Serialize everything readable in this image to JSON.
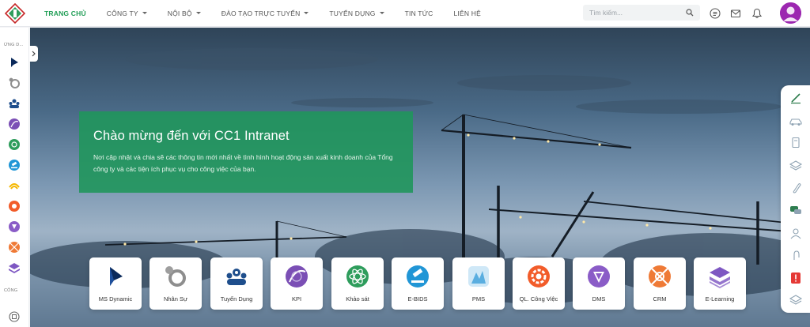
{
  "nav": {
    "items": [
      {
        "label": "TRANG CHỦ",
        "active": true,
        "dropdown": false
      },
      {
        "label": "CÔNG TY",
        "active": false,
        "dropdown": true
      },
      {
        "label": "NỘI BỘ",
        "active": false,
        "dropdown": true
      },
      {
        "label": "ĐÀO TẠO TRỰC TUYẾN",
        "active": false,
        "dropdown": true
      },
      {
        "label": "TUYỂN DỤNG",
        "active": false,
        "dropdown": true
      },
      {
        "label": "TIN TỨC",
        "active": false,
        "dropdown": false
      },
      {
        "label": "LIÊN HỆ",
        "active": false,
        "dropdown": false
      }
    ],
    "search_placeholder": "Tìm kiếm...",
    "icons": [
      "search-icon",
      "document-icon",
      "mail-icon",
      "bell-icon",
      "user-avatar"
    ]
  },
  "left_rail": {
    "section_apps_label": "ỨNG D...",
    "section_tools_label": "CÔNG",
    "icons": [
      "ms-dynamic-icon",
      "nhan-su-icon",
      "tuyen-dung-icon",
      "kpi-icon",
      "khao-sat-icon",
      "e-bids-icon",
      "pms-icon",
      "ql-cong-viec-icon",
      "dms-icon",
      "crm-icon",
      "e-learning-icon",
      "tool-icon"
    ]
  },
  "hero": {
    "title": "Chào mừng đến với CC1 Intranet",
    "subtitle": "Nơi cập nhật và chia sẽ các thông tin mới nhất về tình hình hoạt động sản xuất kinh doanh của Tổng công ty và các tiện ích phục vụ cho công việc của bạn."
  },
  "apps": [
    {
      "label": "MS Dynamic",
      "icon": "ms-dynamic-icon",
      "color": "#0b2a5b"
    },
    {
      "label": "Nhân Sự",
      "icon": "nhan-su-icon",
      "color": "#8e8e8e"
    },
    {
      "label": "Tuyển Dụng",
      "icon": "tuyen-dung-icon",
      "color": "#1e4e8c"
    },
    {
      "label": "KPI",
      "icon": "kpi-icon",
      "color": "#7b4fb5"
    },
    {
      "label": "Khảo sát",
      "icon": "khao-sat-icon",
      "color": "#2e9d5c"
    },
    {
      "label": "E-BIDS",
      "icon": "e-bids-icon",
      "color": "#2196d6"
    },
    {
      "label": "PMS",
      "icon": "pms-icon",
      "color": "#5aaee0"
    },
    {
      "label": "QL. Công Việc",
      "icon": "ql-cong-viec-icon",
      "color": "#f25c2a"
    },
    {
      "label": "DMS",
      "icon": "dms-icon",
      "color": "#8a5cc7"
    },
    {
      "label": "CRM",
      "icon": "crm-icon",
      "color": "#ef7a36"
    },
    {
      "label": "E-Learning",
      "icon": "e-learning-icon",
      "color": "#7e57c2"
    }
  ],
  "right_toolbar": {
    "icons": [
      "edit-icon",
      "car-icon",
      "document-icon",
      "layers-icon",
      "attachment-icon",
      "chat-icon",
      "contact-icon",
      "pin-icon",
      "alert-icon",
      "stack-icon"
    ]
  },
  "colors": {
    "brand_green": "#1f9d55",
    "welcome_bg": "#20965c"
  }
}
